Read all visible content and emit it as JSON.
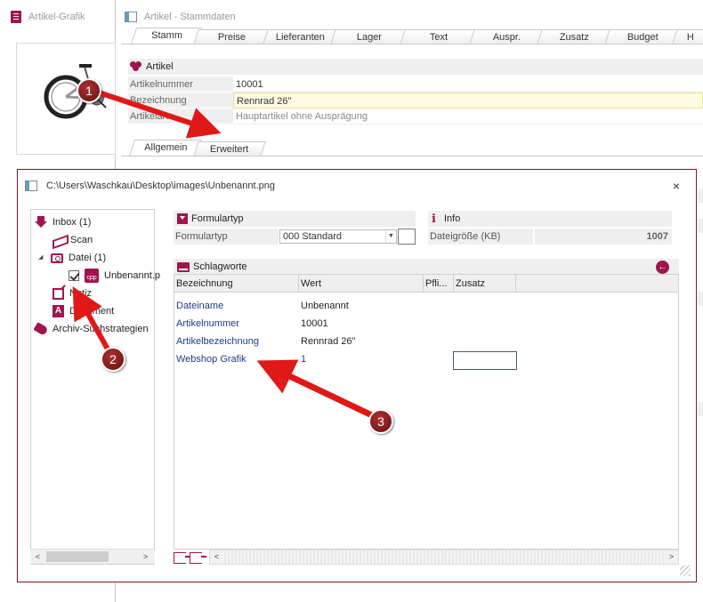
{
  "left_panel": {
    "title": "Artikel-Grafik"
  },
  "stammdaten": {
    "title": "Artikel - Stammdaten",
    "tabs": [
      "Stamm",
      "Preise",
      "Lieferanten",
      "Lager",
      "Text",
      "Auspr.",
      "Zusatz",
      "Budget",
      "H"
    ],
    "active_tab": "Stamm",
    "section_title": "Artikel",
    "fields": [
      {
        "label": "Artikelnummer",
        "value": "10001"
      },
      {
        "label": "Bezeichnung",
        "value": "Rennrad 26\""
      },
      {
        "label": "Artikelart",
        "value": "Hauptartikel ohne Ausprägung"
      }
    ],
    "subtabs": [
      "Allgemein",
      "Erweitert"
    ],
    "active_subtab": "Allgemein"
  },
  "dialog": {
    "title": "C:\\Users\\Waschkau\\Desktop\\images\\Unbenannt.png",
    "close_label": "×",
    "tree": [
      {
        "label": "Inbox (1)",
        "icon": "inbox-icon"
      },
      {
        "label": "Scan",
        "icon": "scan-icon"
      },
      {
        "label": "Datei (1)",
        "icon": "camera-icon"
      },
      {
        "label": "Unbenannt.p",
        "icon": "file-cpp-icon"
      },
      {
        "label": "Notiz",
        "icon": "note-icon"
      },
      {
        "label": "Dokument",
        "icon": "document-icon"
      },
      {
        "label": "Archiv-Suchstrategien",
        "icon": "tag-icon"
      }
    ],
    "formulartyp": {
      "section_title": "Formulartyp",
      "label": "Formulartyp",
      "value": "000 Standard"
    },
    "info": {
      "section_title": "Info",
      "label": "Dateigröße (KB)",
      "value": "1007"
    },
    "schlagworte": {
      "section_title": "Schlagworte",
      "columns": [
        "Bezeichnung",
        "Wert",
        "Pfli...",
        "Zusatz"
      ],
      "rows": [
        {
          "name": "Dateiname",
          "value": "Unbenannt"
        },
        {
          "name": "Artikelnummer",
          "value": "10001"
        },
        {
          "name": "Artikelbezeichnung",
          "value": "Rennrad 26\""
        },
        {
          "name": "Webshop Grafik",
          "value": "1"
        }
      ]
    }
  },
  "annotations": {
    "badge1": "1",
    "badge2": "2",
    "badge3": "3"
  },
  "colors": {
    "brand": "#a0154e",
    "arrow": "#e01818",
    "badge": "#8b1a1a",
    "dialog_border": "#7e1b2b",
    "link": "#1f3a8a"
  }
}
